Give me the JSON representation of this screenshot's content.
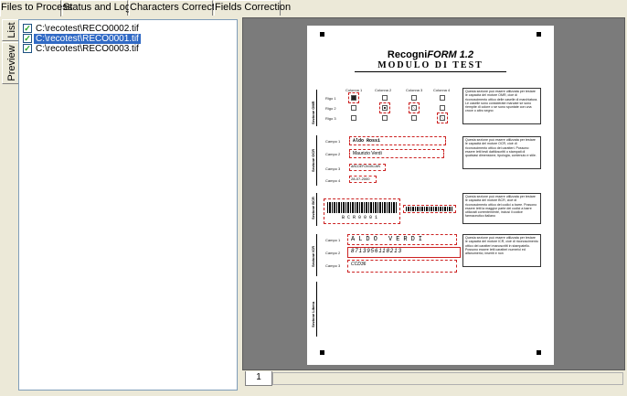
{
  "tabs": [
    "Files to Process",
    "Status and Log",
    "Characters Correction",
    "Fields Correction"
  ],
  "side_tabs": [
    "List",
    "Preview"
  ],
  "files": [
    {
      "name": "C:\\recotest\\RECO0002.tif",
      "checked": true,
      "selected": false
    },
    {
      "name": "C:\\recotest\\RECO0001.tif",
      "checked": true,
      "selected": true
    },
    {
      "name": "C:\\recotest\\RECO0003.tif",
      "checked": true,
      "selected": false
    }
  ],
  "document": {
    "title_prefix": "Recogni",
    "title_emph": "FORM 1.2",
    "subtitle": "MODULO DI TEST",
    "omr": {
      "section": "Sezione OMR",
      "columns": [
        "Colonna 1",
        "Colonna 2",
        "Colonna 3",
        "Colonna 4"
      ],
      "rows": [
        "Rigo 1",
        "Rigo 2",
        "Rigo 3"
      ],
      "description": "Questa sezione può essere utilizzata per testare le capacità del motore OMR, cioè di riconoscimento ottico delle caselle di marchiatura. Le caselle sono considerate marcate se sono riempite di colore o se sono spuntate con una croce o altro segno"
    },
    "ocr": {
      "section": "Sezione OCR",
      "fields": [
        "Campo 1",
        "Campo 2",
        "Campo 3",
        "Campo 4"
      ],
      "values": [
        "Aldo Rossi",
        "Maurizio Verdi",
        "ABCDEFGHIJKLMN",
        "28-07-2000"
      ],
      "description": "Questa sezione può essere utilizzata per testare le capacità del motore OCR, cioè di riconoscimento ottico dei caratteri. Possono essere letti testi dattiloscritti o stampati di qualsiasi dimensione, tipologia, contenuto e stile."
    },
    "bcr": {
      "section": "Sezione BCR",
      "code": "BCR0001",
      "description": "Questa sezione può essere utilizzata per testare le capacità del motore BCR, cioè di riconoscimento ottico dei codici a barre. Possono essere letti la maggior parte dei codici a barre utilizzati correntemente, inclusi il codice farmaceutico italiano"
    },
    "icr": {
      "section": "Sezione ICR",
      "fields": [
        "Campo 1",
        "Campo 2",
        "Campo 3"
      ],
      "values": [
        "ALDO VERDI",
        "8713956118213",
        "CCD36"
      ],
      "description": "Questa sezione può essere utilizzata per testare le capacità del motore ICR, cioè di riconoscimento ottico dei caratteri manoscritti in stampatello. Possono essere letti caratteri numerici ed alfanumerici, inseriti e non"
    },
    "libera": {
      "section": "Sezione Libera"
    }
  },
  "page_tabs": [
    "1"
  ]
}
